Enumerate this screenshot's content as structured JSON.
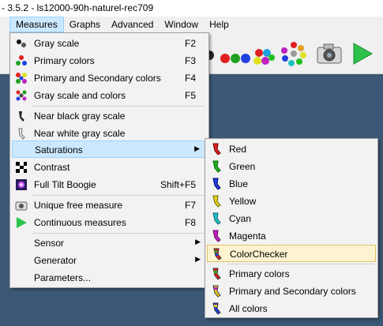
{
  "title": "- 3.5.2 - ls12000-90h-naturel-rec709",
  "menubar": [
    {
      "label": "Measures",
      "active": true
    },
    {
      "label": "Graphs"
    },
    {
      "label": "Advanced"
    },
    {
      "label": "Window"
    },
    {
      "label": "Help"
    }
  ],
  "measures_menu": {
    "gray_scale": {
      "label": "Gray scale",
      "shortcut": "F2"
    },
    "primary_colors": {
      "label": "Primary colors",
      "shortcut": "F3"
    },
    "primary_secondary": {
      "label": "Primary and Secondary colors",
      "shortcut": "F4"
    },
    "gray_scale_colors": {
      "label": "Gray scale and colors",
      "shortcut": "F5"
    },
    "near_black": {
      "label": "Near black gray scale"
    },
    "near_white": {
      "label": "Near white gray scale"
    },
    "saturations": {
      "label": "Saturations"
    },
    "contrast": {
      "label": "Contrast"
    },
    "full_tilt": {
      "label": "Full Tilt Boogie",
      "shortcut": "Shift+F5"
    },
    "unique_free": {
      "label": "Unique free measure",
      "shortcut": "F7"
    },
    "continuous": {
      "label": "Continuous measures",
      "shortcut": "F8"
    },
    "sensor": {
      "label": "Sensor"
    },
    "generator": {
      "label": "Generator"
    },
    "parameters": {
      "label": "Parameters..."
    }
  },
  "saturations_menu": {
    "red": "Red",
    "green": "Green",
    "blue": "Blue",
    "yellow": "Yellow",
    "cyan": "Cyan",
    "magenta": "Magenta",
    "colorchecker": "ColorChecker",
    "primary_colors": "Primary colors",
    "primary_secondary": "Primary and Secondary colors",
    "all_colors": "All colors"
  }
}
